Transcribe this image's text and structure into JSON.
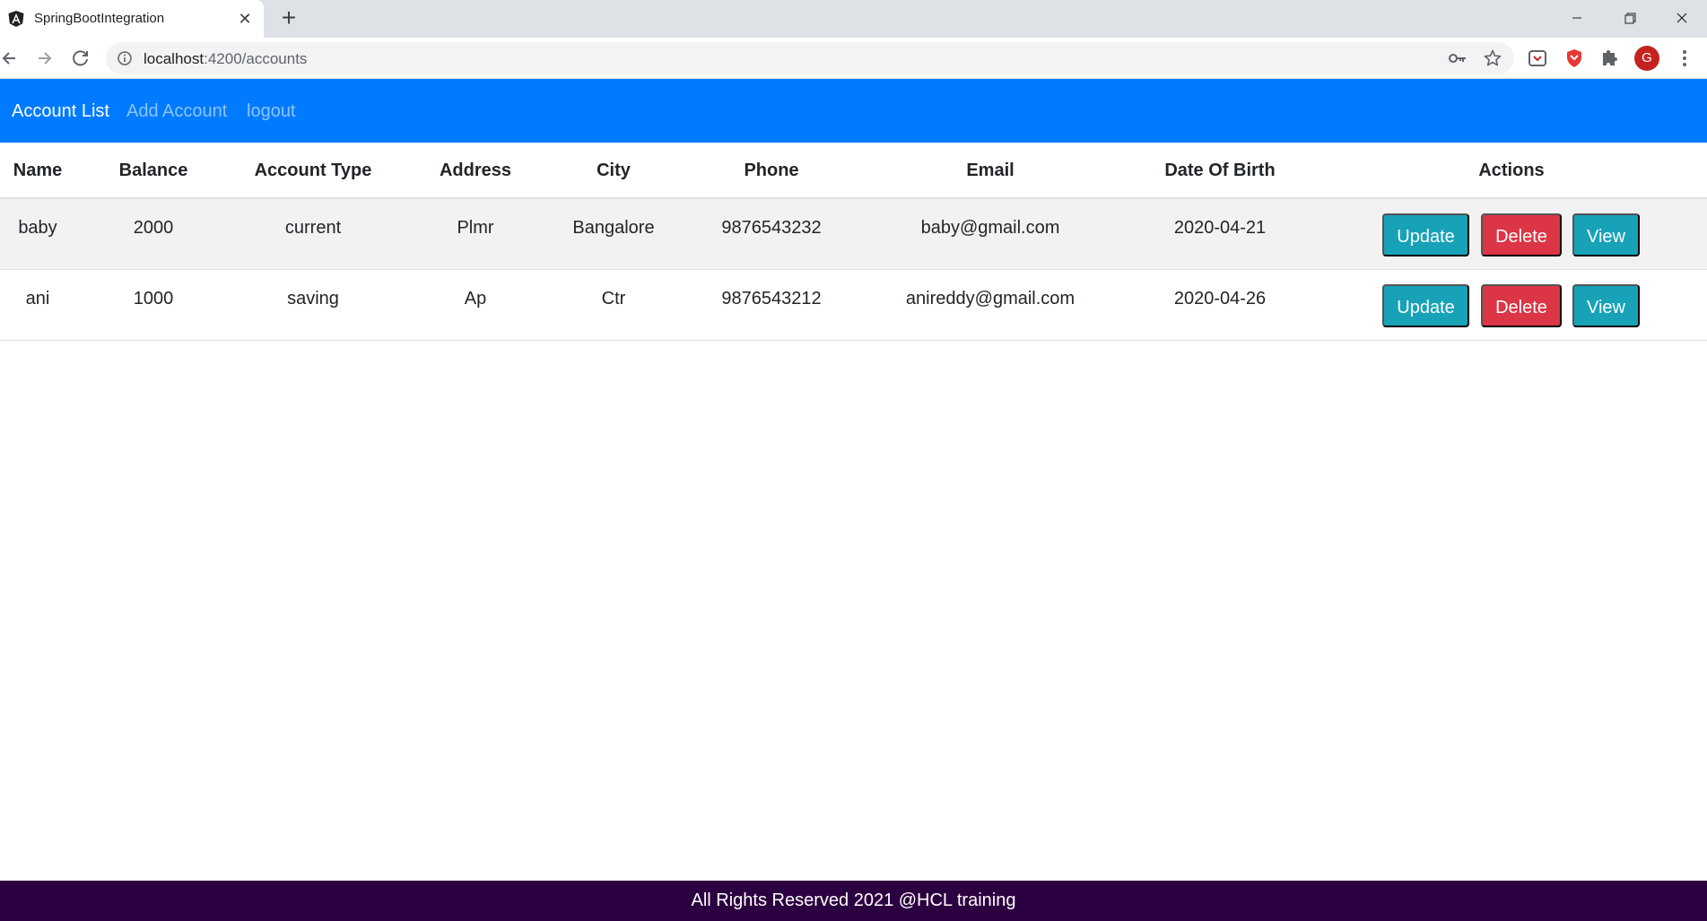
{
  "browser": {
    "tab_title": "SpringBootIntegration",
    "url_host": "localhost",
    "url_rest": ":4200/accounts",
    "profile_initial": "G"
  },
  "nav": {
    "links": [
      {
        "label": "Account List",
        "active": true
      },
      {
        "label": "Add Account",
        "active": false
      },
      {
        "label": "logout",
        "active": false
      }
    ]
  },
  "table": {
    "headers": [
      "Name",
      "Balance",
      "Account Type",
      "Address",
      "City",
      "Phone",
      "Email",
      "Date Of Birth",
      "Actions"
    ],
    "rows": [
      [
        "baby",
        "2000",
        "current",
        "Plmr",
        "Bangalore",
        "9876543232",
        "baby@gmail.com",
        "2020-04-21"
      ],
      [
        "ani",
        "1000",
        "saving",
        "Ap",
        "Ctr",
        "9876543212",
        "anireddy@gmail.com",
        "2020-04-26"
      ]
    ],
    "actions": {
      "update": "Update",
      "delete": "Delete",
      "view": "View"
    }
  },
  "footer": {
    "text": "All Rights Reserved 2021 @HCL training"
  },
  "colors": {
    "navbar": "#007bff",
    "update_button": "#17a2b8",
    "delete_button": "#dc3545",
    "view_button": "#17a2b8",
    "footer": "#2c0040"
  }
}
